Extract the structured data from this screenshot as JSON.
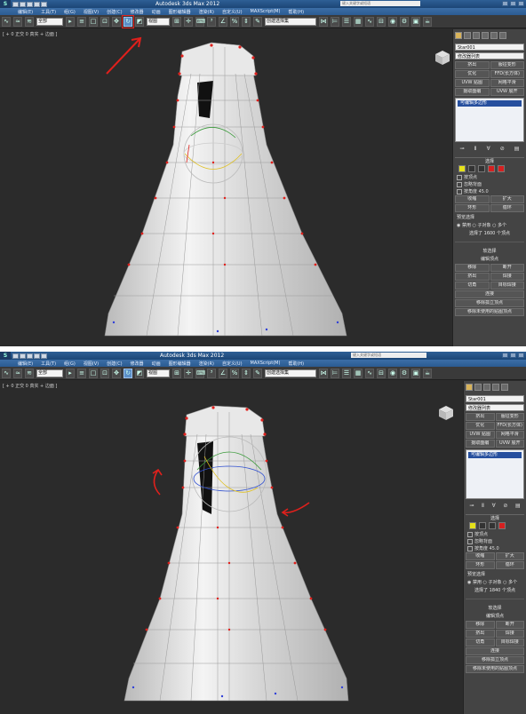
{
  "app_title": "Autodesk 3ds Max  2012",
  "search_placeholder": "键入关键字或短语",
  "menu": [
    "编辑(E)",
    "工具(T)",
    "组(G)",
    "视图(V)",
    "创建(C)",
    "修改器",
    "动画",
    "图形编辑器",
    "渲染(R)",
    "自定义(U)",
    "MAXScript(M)",
    "帮助(H)"
  ],
  "toolbar": {
    "select_filter": "全部",
    "ref_coord": "视图",
    "named_selection": "创建选择集"
  },
  "viewport_label": "[ + 0 正交 0 真实 + 边面 ]",
  "panel": {
    "object_name": "Star001",
    "modifier_list": "修改器列表",
    "buttons": [
      [
        "挤出",
        "服征变形"
      ],
      [
        "优化",
        "FFD(长方体)"
      ],
      [
        "UVW 贴图",
        "网格平滑"
      ],
      [
        "摄取面编",
        "UVW 展开"
      ]
    ],
    "stack_item": "可编辑多边形",
    "selection_title": "选择",
    "by_vertex": "按顶点",
    "ignore_backfacing": "忽略背面",
    "by_angle": "按角度",
    "angle_value": "45.0",
    "shrink": "收缩",
    "grow": "扩大",
    "ring": "环形",
    "loop": "循环",
    "preview_selection": "预览选择",
    "preview_opts": [
      "禁用",
      "子对象",
      "多个"
    ],
    "soft_selection": "软选择",
    "edit_vertices": "编辑顶点",
    "remove": "移除",
    "break": "断开",
    "extrude": "挤出",
    "weld": "焊接",
    "chamfer": "切角",
    "target_weld": "目标焊接",
    "connect": "连接",
    "remove_isolated": "移除孤立顶点",
    "remove_unused_map": "移除未使用的贴图顶点"
  },
  "screens": [
    {
      "selected_text": "选择了 1600 个顶点"
    },
    {
      "selected_text": "选择了 1840 个顶点"
    }
  ],
  "colors": {
    "selected_vertex": "#e0201c",
    "annotation": "#e0201c",
    "vertex": "#3040d8"
  }
}
